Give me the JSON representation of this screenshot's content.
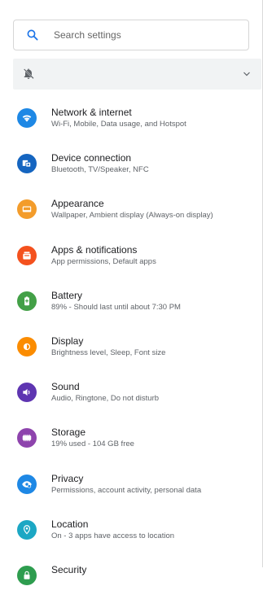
{
  "search": {
    "placeholder": "Search settings"
  },
  "dnd_bar": {
    "icon": "bell-off-icon",
    "expand_icon": "chevron-down-icon"
  },
  "items": [
    {
      "title": "Network & internet",
      "subtitle": "Wi-Fi, Mobile, Data usage, and Hotspot",
      "icon": "wifi-icon",
      "color": "#1e88e5"
    },
    {
      "title": "Device connection",
      "subtitle": "Bluetooth, TV/Speaker, NFC",
      "icon": "devices-icon",
      "color": "#1565c0"
    },
    {
      "title": "Appearance",
      "subtitle": "Wallpaper, Ambient display (Always-on display)",
      "icon": "wallpaper-icon",
      "color": "#f39c2b"
    },
    {
      "title": "Apps & notifications",
      "subtitle": "App permissions, Default apps",
      "icon": "apps-icon",
      "color": "#f4511e"
    },
    {
      "title": "Battery",
      "subtitle": "89% - Should last until about 7:30 PM",
      "icon": "battery-icon",
      "color": "#43a047"
    },
    {
      "title": "Display",
      "subtitle": "Brightness level, Sleep, Font size",
      "icon": "brightness-icon",
      "color": "#fb8c00"
    },
    {
      "title": "Sound",
      "subtitle": "Audio, Ringtone, Do not disturb",
      "icon": "volume-icon",
      "color": "#5e35b1"
    },
    {
      "title": "Storage",
      "subtitle": "19% used - 104 GB free",
      "icon": "storage-icon",
      "color": "#8e44ad"
    },
    {
      "title": "Privacy",
      "subtitle": "Permissions, account activity, personal data",
      "icon": "privacy-eye-icon",
      "color": "#1e88e5"
    },
    {
      "title": "Location",
      "subtitle": "On - 3 apps have access to location",
      "icon": "location-pin-icon",
      "color": "#1ca7c4"
    },
    {
      "title": "Security",
      "subtitle": "",
      "icon": "lock-icon",
      "color": "#2e9d4f"
    }
  ]
}
